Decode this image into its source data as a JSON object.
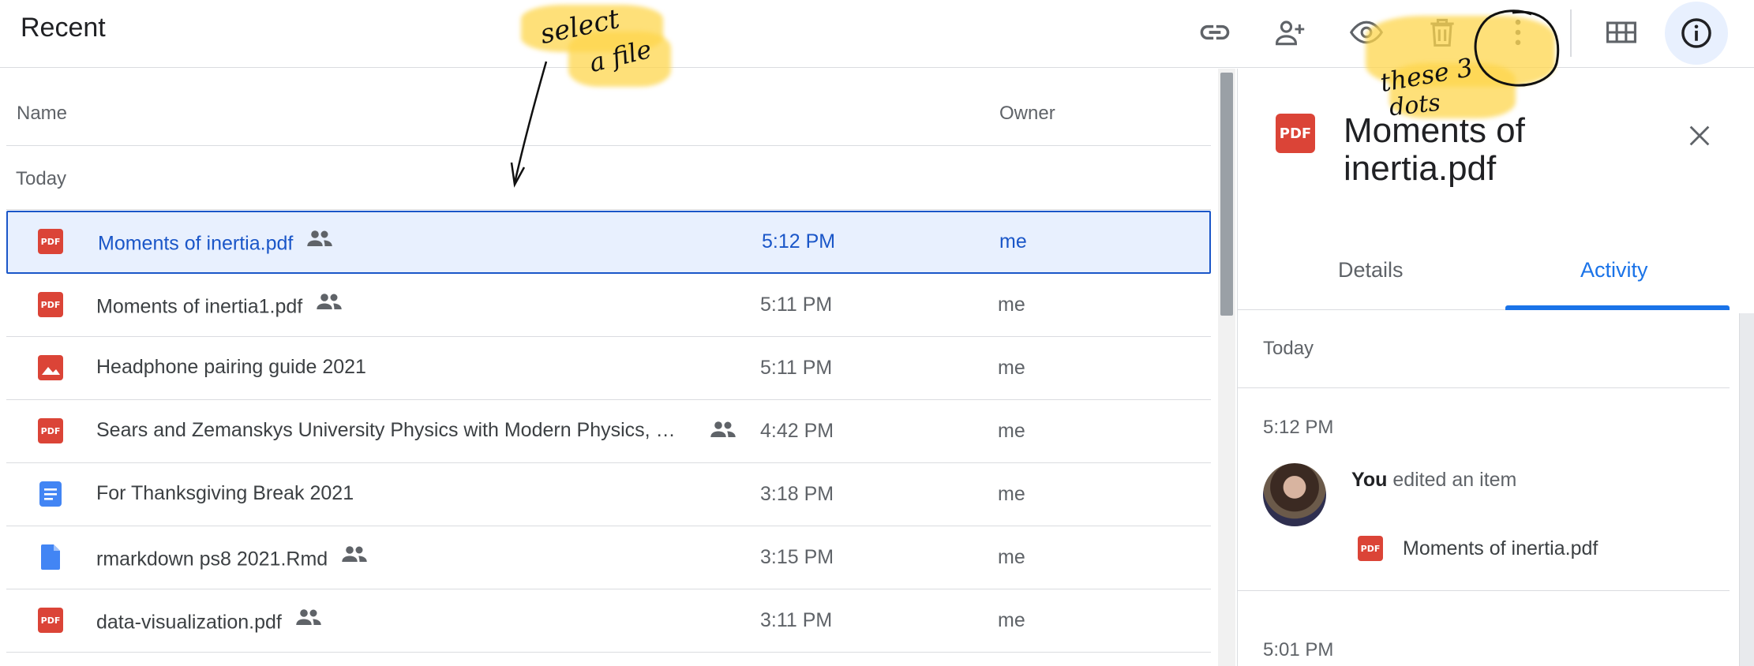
{
  "header": {
    "title": "Recent",
    "toolbar": [
      {
        "name": "get-link-icon"
      },
      {
        "name": "share-icon"
      },
      {
        "name": "preview-icon"
      },
      {
        "name": "trash-icon"
      },
      {
        "name": "more-vertical-icon"
      },
      {
        "name": "grid-view-icon"
      },
      {
        "name": "info-icon"
      }
    ]
  },
  "list": {
    "columns": {
      "name": "Name",
      "owner": "Owner"
    },
    "section": "Today",
    "rows": [
      {
        "type": "pdf",
        "name": "Moments of inertia.pdf",
        "shared": true,
        "time": "5:12 PM",
        "owner": "me",
        "selected": true
      },
      {
        "type": "pdf",
        "name": "Moments of inertia1.pdf",
        "shared": true,
        "time": "5:11 PM",
        "owner": "me",
        "selected": false
      },
      {
        "type": "image",
        "name": "Headphone pairing guide 2021",
        "shared": false,
        "time": "5:11 PM",
        "owner": "me",
        "selected": false
      },
      {
        "type": "pdf",
        "name": "Sears and Zemanskys University Physics with Modern Physics, …",
        "shared": true,
        "time": "4:42 PM",
        "owner": "me",
        "selected": false
      },
      {
        "type": "doc",
        "name": "For Thanksgiving Break 2021",
        "shared": false,
        "time": "3:18 PM",
        "owner": "me",
        "selected": false
      },
      {
        "type": "file",
        "name": "rmarkdown ps8 2021.Rmd",
        "shared": true,
        "time": "3:15 PM",
        "owner": "me",
        "selected": false
      },
      {
        "type": "pdf",
        "name": "data-visualization.pdf",
        "shared": true,
        "time": "3:11 PM",
        "owner": "me",
        "selected": false
      }
    ]
  },
  "panel": {
    "file_badge": "PDF",
    "file_name": "Moments of inertia.pdf",
    "tabs": {
      "details": "Details",
      "activity": "Activity"
    },
    "activity": {
      "section": "Today",
      "entries": [
        {
          "time": "5:12 PM",
          "actor": "You",
          "action": " edited an item",
          "file": "Moments of inertia.pdf"
        },
        {
          "time": "5:01 PM"
        }
      ]
    }
  },
  "annotations": {
    "select_file": [
      "select",
      "a file"
    ],
    "three_dots": [
      "these 3",
      "dots"
    ]
  },
  "colors": {
    "accent": "#1a73e8",
    "selected_bg": "#e8f0fe",
    "pdf_red": "#db4437",
    "doc_blue": "#4285f4",
    "highlighter": "#fdd64c"
  }
}
